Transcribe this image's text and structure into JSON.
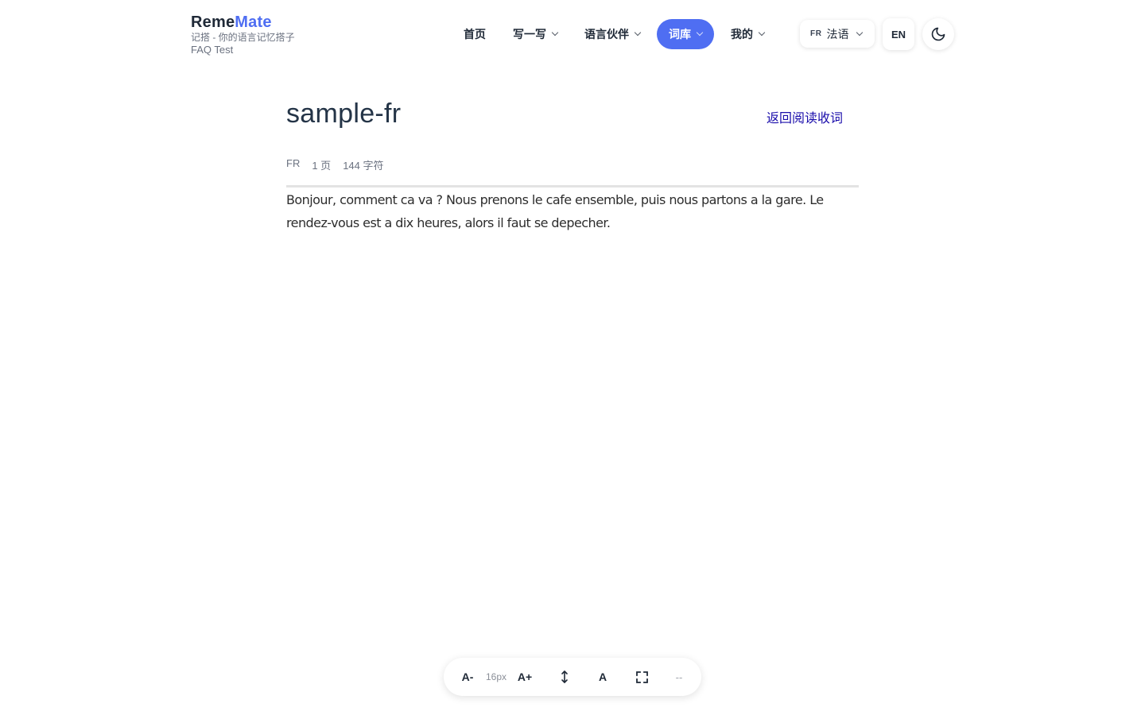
{
  "brand": {
    "name_part1": "Reme",
    "name_part2": "Mate",
    "subtitle": "记搭 - 你的语言记忆搭子",
    "user": "FAQ Test"
  },
  "nav": {
    "items": [
      {
        "label": "首页",
        "dropdown": false
      },
      {
        "label": "写一写",
        "dropdown": true
      },
      {
        "label": "语言伙伴",
        "dropdown": true
      },
      {
        "label": "词库",
        "dropdown": true,
        "active": true
      },
      {
        "label": "我的",
        "dropdown": true
      }
    ],
    "language_code": "FR",
    "language_name": "法语",
    "ui_language": "EN",
    "theme_icon": "moon-icon",
    "accent_color": "#4f6ef2"
  },
  "document": {
    "title": "sample-fr",
    "back_link": "返回阅读收词",
    "meta": {
      "language": "FR",
      "pages": "1 页",
      "chars": "144 字符"
    },
    "text": "Bonjour, comment ca va ? Nous prenons le cafe ensemble, puis nous partons a la gare. Le rendez-vous est a dix heures, alors il faut se depecher."
  },
  "toolbar": {
    "decrease_font": "A-",
    "font_size": "16px",
    "increase_font": "A+",
    "line_height_icon": "vertical-arrows-icon",
    "font_toggle": "A",
    "fullscreen_icon": "fullscreen-icon",
    "placeholder": "--"
  }
}
